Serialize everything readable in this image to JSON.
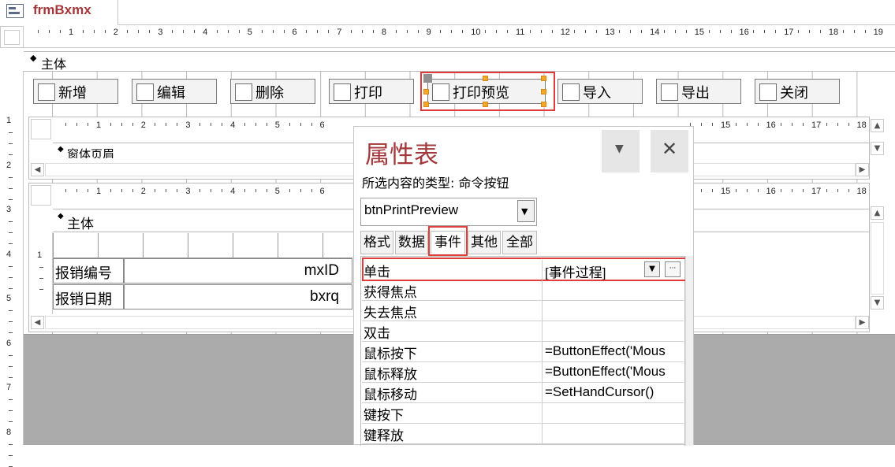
{
  "document": {
    "tab_title": "frmBxmx"
  },
  "rulers": {
    "main_h": [
      "1",
      "2",
      "3",
      "4",
      "5",
      "6",
      "7",
      "8",
      "9",
      "10",
      "11",
      "12",
      "13",
      "14",
      "15",
      "16",
      "17",
      "18",
      "19"
    ],
    "sub_h_left": [
      "1",
      "2",
      "3",
      "4",
      "5",
      "6"
    ],
    "sub_h_right": [
      "15",
      "16",
      "17",
      "18"
    ],
    "main_v": [
      "1",
      "2",
      "3",
      "4",
      "5",
      "6",
      "7",
      "8"
    ],
    "sub_v": [
      "1"
    ]
  },
  "main_form": {
    "section_label": "主体",
    "buttons": [
      "新增",
      "编辑",
      "删除",
      "打印",
      "打印预览",
      "导入",
      "导出",
      "关闭"
    ]
  },
  "subform_header": {
    "section_label": "窗体页眉"
  },
  "subform_detail": {
    "section_label": "主体",
    "fields": [
      {
        "label": "报销编号",
        "control": "mxID"
      },
      {
        "label": "报销日期",
        "control": "bxrq"
      }
    ]
  },
  "property_sheet": {
    "title": "属性表",
    "selection_type_label": "所选内容的类型:",
    "selection_type_value": "命令按钮",
    "object_name": "btnPrintPreview",
    "tabs": [
      "格式",
      "数据",
      "事件",
      "其他",
      "全部"
    ],
    "active_tab": "事件",
    "rows": [
      {
        "name": "单击",
        "value": "[事件过程]"
      },
      {
        "name": "获得焦点",
        "value": ""
      },
      {
        "name": "失去焦点",
        "value": ""
      },
      {
        "name": "双击",
        "value": ""
      },
      {
        "name": "鼠标按下",
        "value": "=ButtonEffect('Mous"
      },
      {
        "name": "鼠标释放",
        "value": "=ButtonEffect('Mous"
      },
      {
        "name": "鼠标移动",
        "value": "=SetHandCursor()"
      },
      {
        "name": "键按下",
        "value": ""
      },
      {
        "name": "键释放",
        "value": ""
      }
    ],
    "build_button_label": "···"
  },
  "colors": {
    "accent": "#a4373a",
    "highlight": "#e03c3c",
    "selection_handle": "#f5a623"
  }
}
